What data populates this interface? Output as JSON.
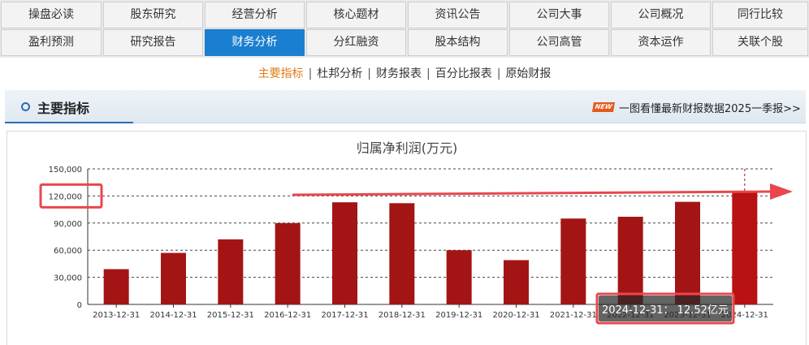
{
  "nav": {
    "row1": [
      "操盘必读",
      "股东研究",
      "经营分析",
      "核心题材",
      "资讯公告",
      "公司大事",
      "公司概况",
      "同行比较"
    ],
    "row2": [
      "盈利预测",
      "研究报告",
      "财务分析",
      "分红融资",
      "股本结构",
      "公司高管",
      "资本运作",
      "关联个股"
    ],
    "active": "财务分析"
  },
  "subtabs": {
    "items": [
      "主要指标",
      "杜邦分析",
      "财务报表",
      "百分比报表",
      "原始财报"
    ],
    "active": "主要指标"
  },
  "section": {
    "title": "主要指标",
    "badge": "NEW",
    "news_link": "一图看懂最新财报数据2025一季报>>"
  },
  "colors": {
    "accent_blue": "#1a7fd0",
    "bar": "#a31515",
    "bar_last": "#b81212",
    "annotation_red": "#e8474c",
    "active_tab": "#e37a14"
  },
  "chart_data": {
    "type": "bar",
    "title": "归属净利润(万元)",
    "categories": [
      "2013-12-31",
      "2014-12-31",
      "2015-12-31",
      "2016-12-31",
      "2017-12-31",
      "2018-12-31",
      "2019-12-31",
      "2020-12-31",
      "2021-12-31",
      "2022-12-31",
      "2023-12-31",
      "2024-12-31"
    ],
    "series": [
      {
        "values": [
          39000,
          57000,
          72000,
          90000,
          113000,
          112000,
          60000,
          49000,
          95000,
          97000,
          113500,
          125200
        ]
      }
    ],
    "ylim": [
      0,
      150000
    ],
    "yticks": [
      "0",
      "30,000",
      "60,000",
      "90,000",
      "120,000",
      "150,000"
    ],
    "ytick_values": [
      0,
      30000,
      60000,
      90000,
      120000,
      150000
    ],
    "grid": true,
    "tooltip": "2024-12-31： 12.52亿元",
    "hover_index": 11,
    "highlight_tick": "120,000"
  }
}
